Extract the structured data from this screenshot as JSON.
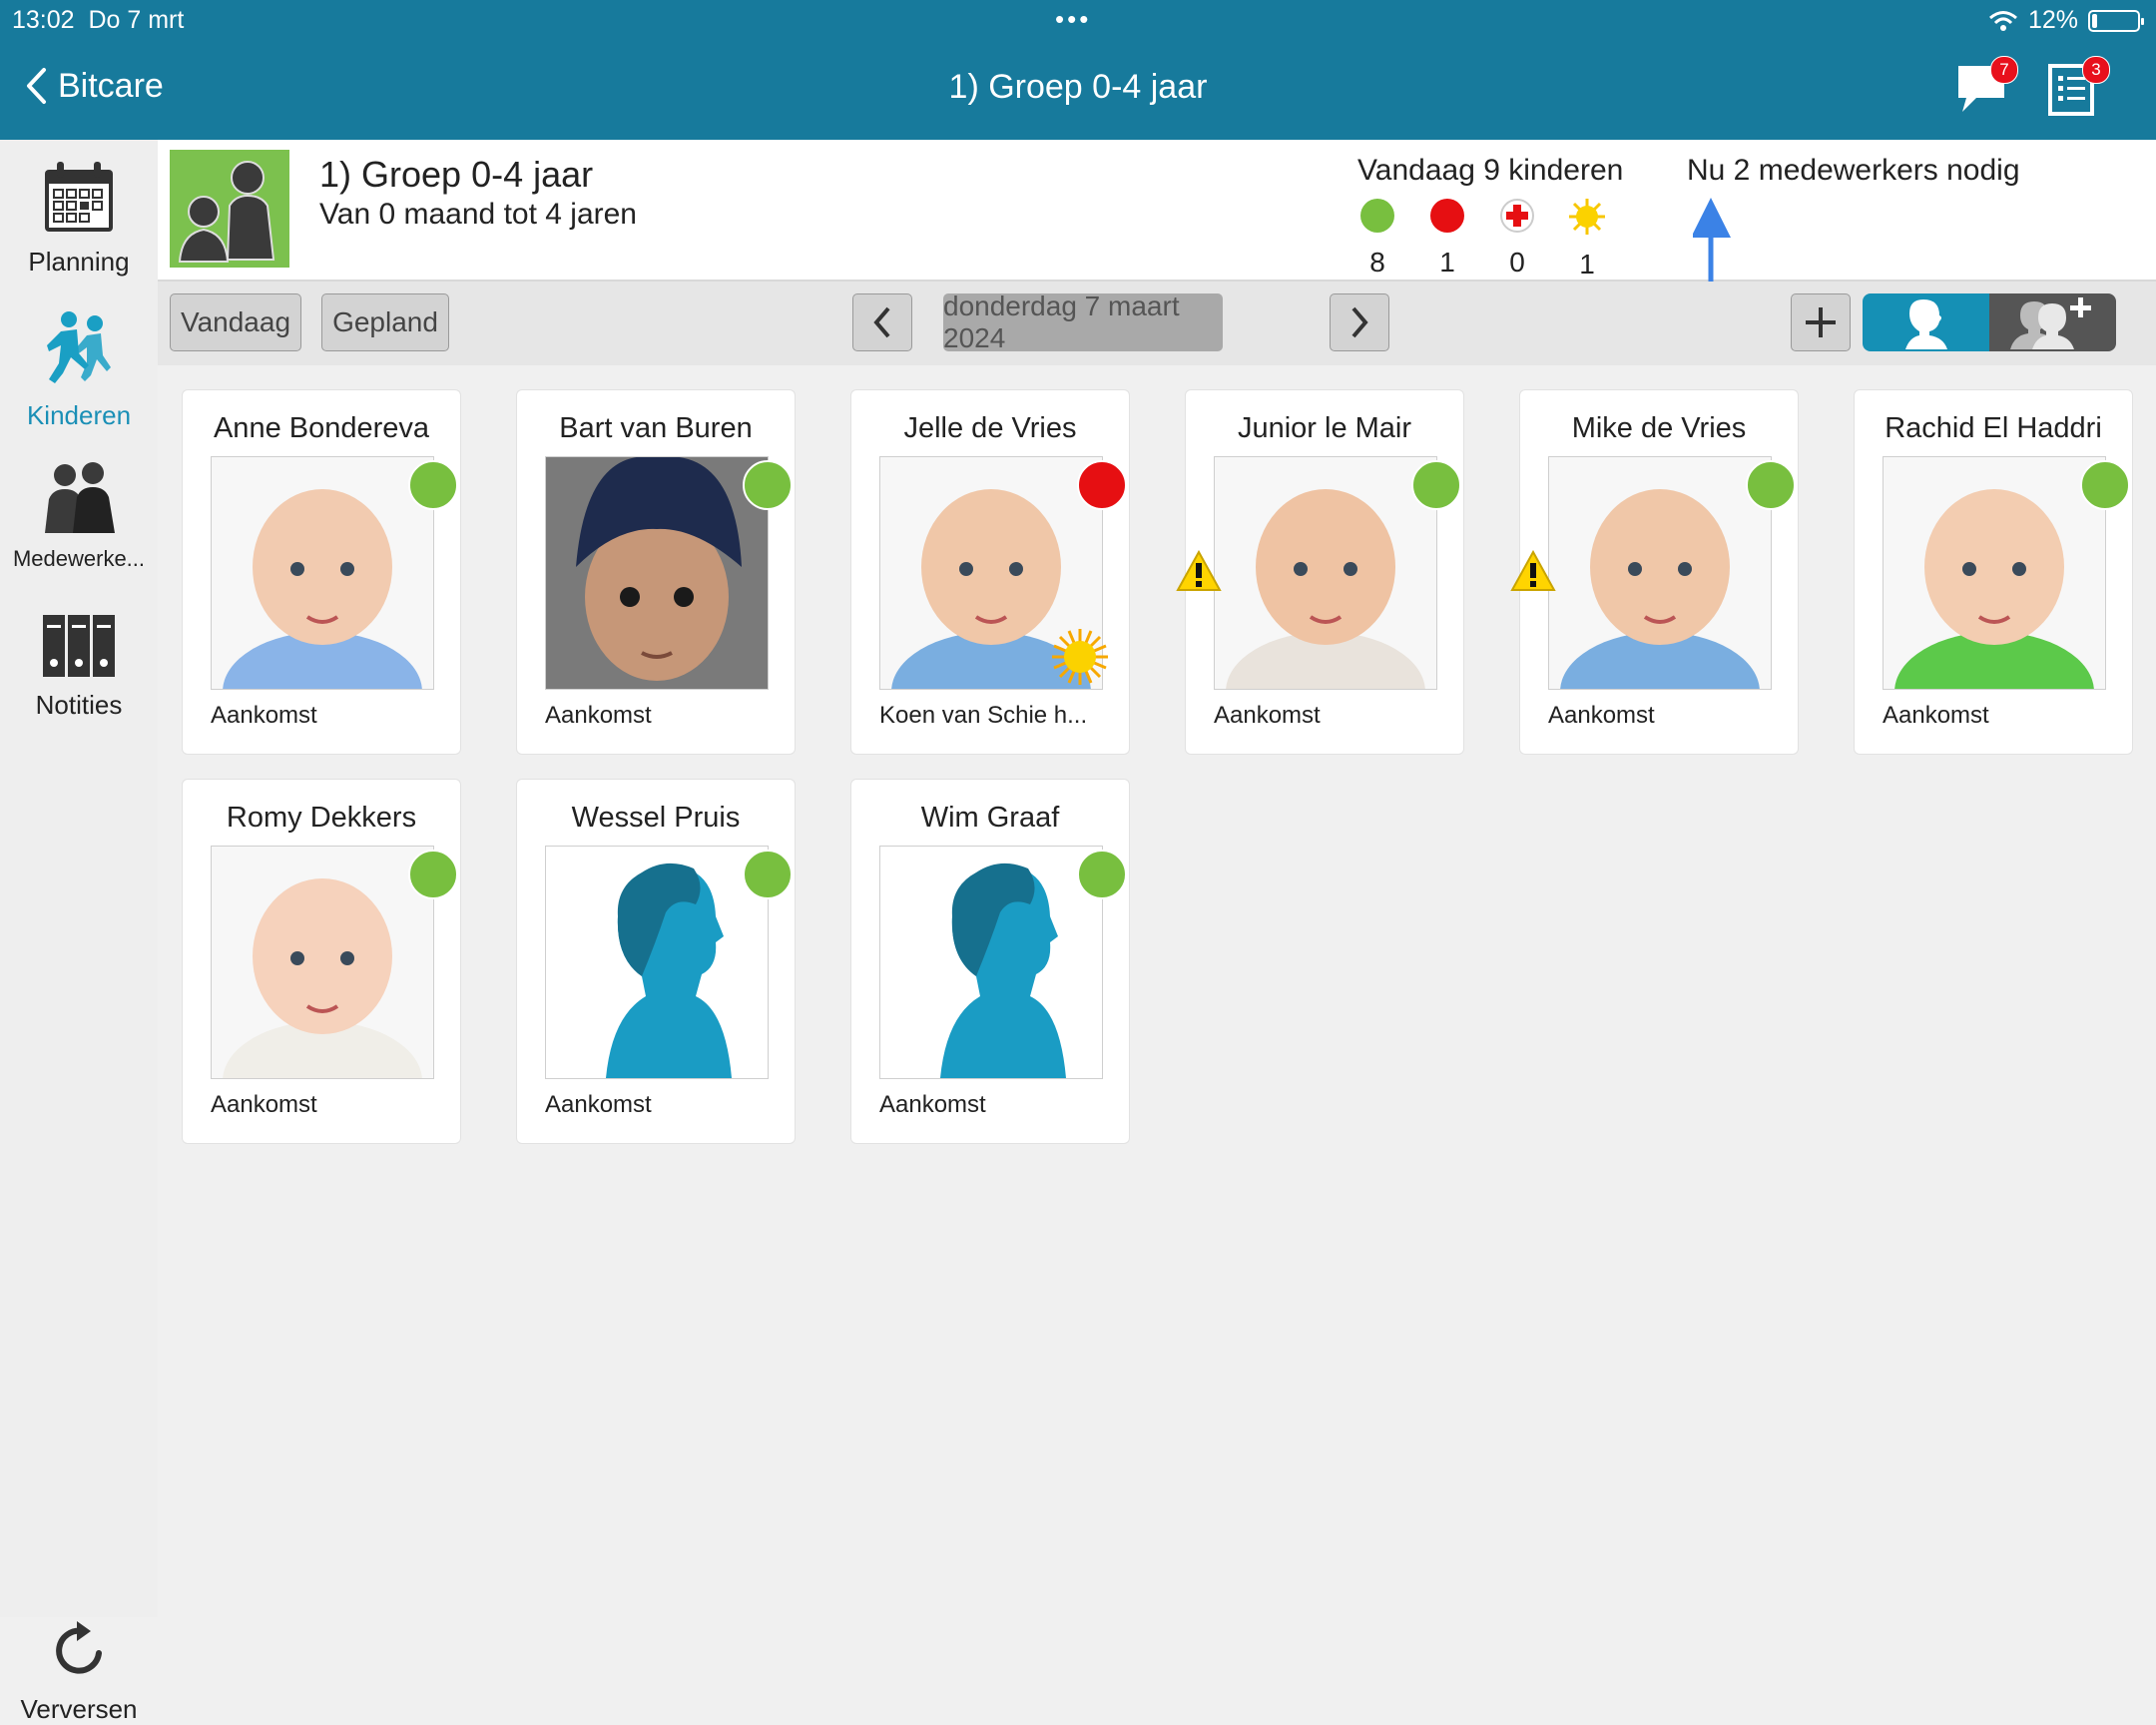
{
  "status_bar": {
    "time": "13:02",
    "date": "Do 7 mrt",
    "battery": "12%",
    "battery_level": 0.12
  },
  "nav": {
    "back_label": "Bitcare",
    "title": "1) Groep 0-4 jaar",
    "messages_badge": "7",
    "tasks_badge": "3"
  },
  "sidebar": {
    "items": [
      {
        "label": "Planning",
        "icon": "calendar-icon"
      },
      {
        "label": "Kinderen",
        "icon": "children-running-icon"
      },
      {
        "label": "Medewerke...",
        "icon": "staff-silhouettes-icon"
      },
      {
        "label": "Notities",
        "icon": "binders-icon"
      }
    ],
    "active": "Kinderen",
    "refresh_label": "Verversen"
  },
  "group": {
    "title": "1) Groep 0-4 jaar",
    "subtitle": "Van 0 maand tot 4 jaren",
    "today_label": "Vandaag 9 kinderen",
    "stats": [
      {
        "icon": "green-dot-icon",
        "count": "8",
        "color": "#78bf3f"
      },
      {
        "icon": "red-dot-icon",
        "count": "1",
        "color": "#e60f12"
      },
      {
        "icon": "medical-cross-icon",
        "count": "0",
        "color": "#e60f12"
      },
      {
        "icon": "sun-icon",
        "count": "1",
        "color": "#f7c600"
      }
    ],
    "staff_needed": "Nu 2 medewerkers nodig"
  },
  "toolbar": {
    "today_button": "Vandaag",
    "planned_button": "Gepland",
    "date": "donderdag 7 maart 2024"
  },
  "children": [
    {
      "name": "Anne Bondereva",
      "status": "Aankomst",
      "dot": "green",
      "warning": false,
      "sun": false,
      "photo": "baby-photo"
    },
    {
      "name": "Bart van Buren",
      "status": "Aankomst",
      "dot": "green",
      "warning": false,
      "sun": false,
      "photo": "toddler-photo"
    },
    {
      "name": "Jelle  de Vries",
      "status": "Koen van Schie h...",
      "dot": "red",
      "warning": false,
      "sun": true,
      "photo": "baby-photo"
    },
    {
      "name": "Junior le Mair",
      "status": "Aankomst",
      "dot": "green",
      "warning": true,
      "sun": false,
      "photo": "baby-photo"
    },
    {
      "name": "Mike de Vries",
      "status": "Aankomst",
      "dot": "green",
      "warning": true,
      "sun": false,
      "photo": "baby-photo"
    },
    {
      "name": "Rachid El Haddri",
      "status": "Aankomst",
      "dot": "green",
      "warning": false,
      "sun": false,
      "photo": "baby-photo"
    },
    {
      "name": "Romy Dekkers",
      "status": "Aankomst",
      "dot": "green",
      "warning": false,
      "sun": false,
      "photo": "baby-photo"
    },
    {
      "name": "Wessel Pruis",
      "status": "Aankomst",
      "dot": "green",
      "warning": false,
      "sun": false,
      "photo": "silhouette-placeholder"
    },
    {
      "name": "Wim Graaf",
      "status": "Aankomst",
      "dot": "green",
      "warning": false,
      "sun": false,
      "photo": "silhouette-placeholder"
    }
  ],
  "colors": {
    "accent": "#177a9c",
    "active": "#1a8fb6",
    "ok": "#78bf3f",
    "alert": "#e60f12",
    "annotation_arrow": "#3b82e6"
  }
}
